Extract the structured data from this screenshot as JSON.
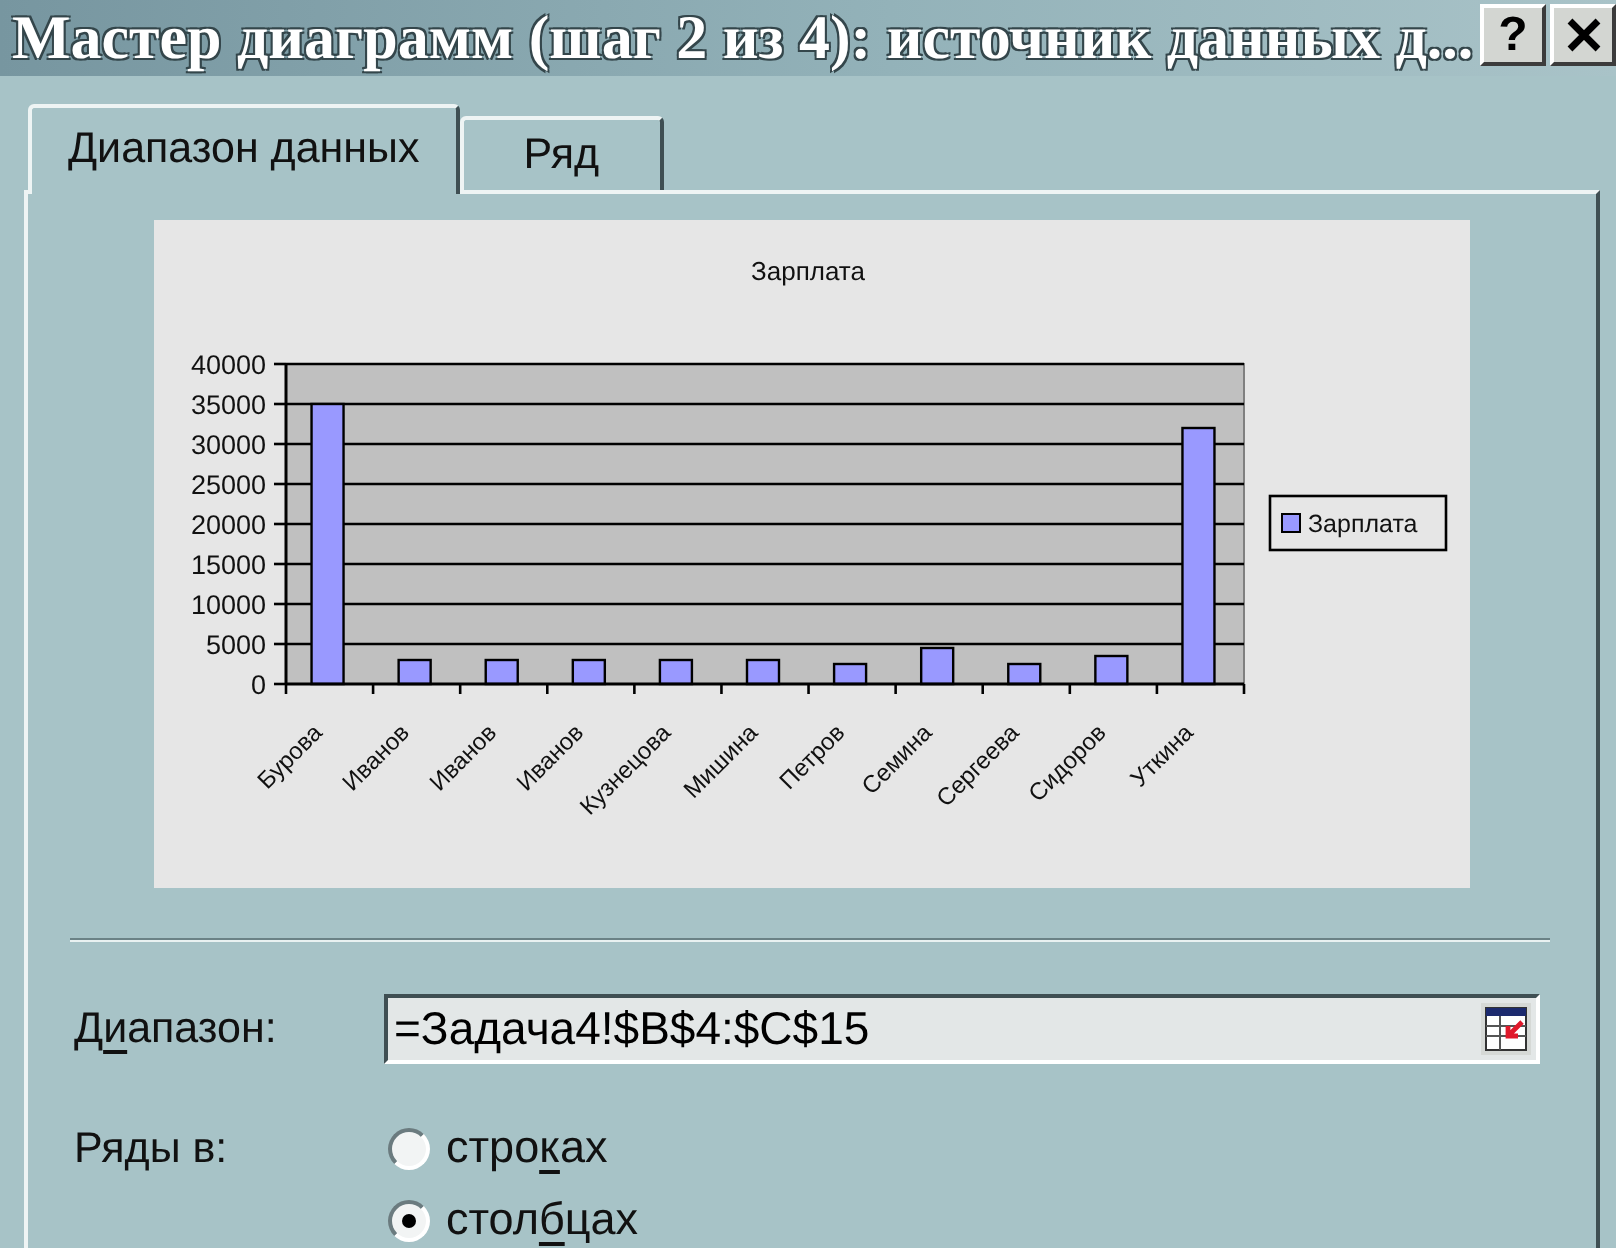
{
  "window": {
    "title": "Мастер диаграмм (шаг 2 из 4): источник данных д...",
    "buttons": [
      {
        "kind": "help",
        "label": "?"
      },
      {
        "kind": "close"
      }
    ]
  },
  "tabs": [
    {
      "label": "Диапазон данных",
      "selected": true
    },
    {
      "label": "Ряд",
      "selected": false
    }
  ],
  "chart": {
    "chart_data": {
      "type": "bar",
      "title": "Зарплата",
      "categories": [
        "Бурова",
        "Иванов",
        "Иванов",
        "Иванов",
        "Кузнецова",
        "Мишина",
        "Петров",
        "Семина",
        "Сергеева",
        "Сидоров",
        "Уткина"
      ],
      "series": [
        {
          "name": "Зарплата",
          "color": "#9999ff",
          "values": [
            35000,
            3000,
            3000,
            3000,
            3000,
            3000,
            2500,
            4500,
            2500,
            3500,
            32000
          ]
        }
      ],
      "ylim": [
        0,
        40000
      ],
      "yticks": [
        0,
        5000,
        10000,
        15000,
        20000,
        25000,
        30000,
        35000,
        40000
      ],
      "grid": true
    }
  },
  "range": {
    "label_parts": [
      {
        "text": "Д",
        "underlined": false
      },
      {
        "text": "и",
        "underlined": true
      },
      {
        "text": "апазон:",
        "underlined": false
      }
    ],
    "value": "=Задача4!$B$4:$C$15"
  },
  "series_in": {
    "label": "Ряды в:",
    "options": [
      {
        "label_parts": [
          {
            "text": "стро",
            "underlined": false
          },
          {
            "text": "к",
            "underlined": true
          },
          {
            "text": "ах",
            "underlined": false
          }
        ],
        "selected": false
      },
      {
        "label_parts": [
          {
            "text": "стол",
            "underlined": false
          },
          {
            "text": "б",
            "underlined": true
          },
          {
            "text": "цах",
            "underlined": false
          }
        ],
        "selected": true
      }
    ]
  }
}
